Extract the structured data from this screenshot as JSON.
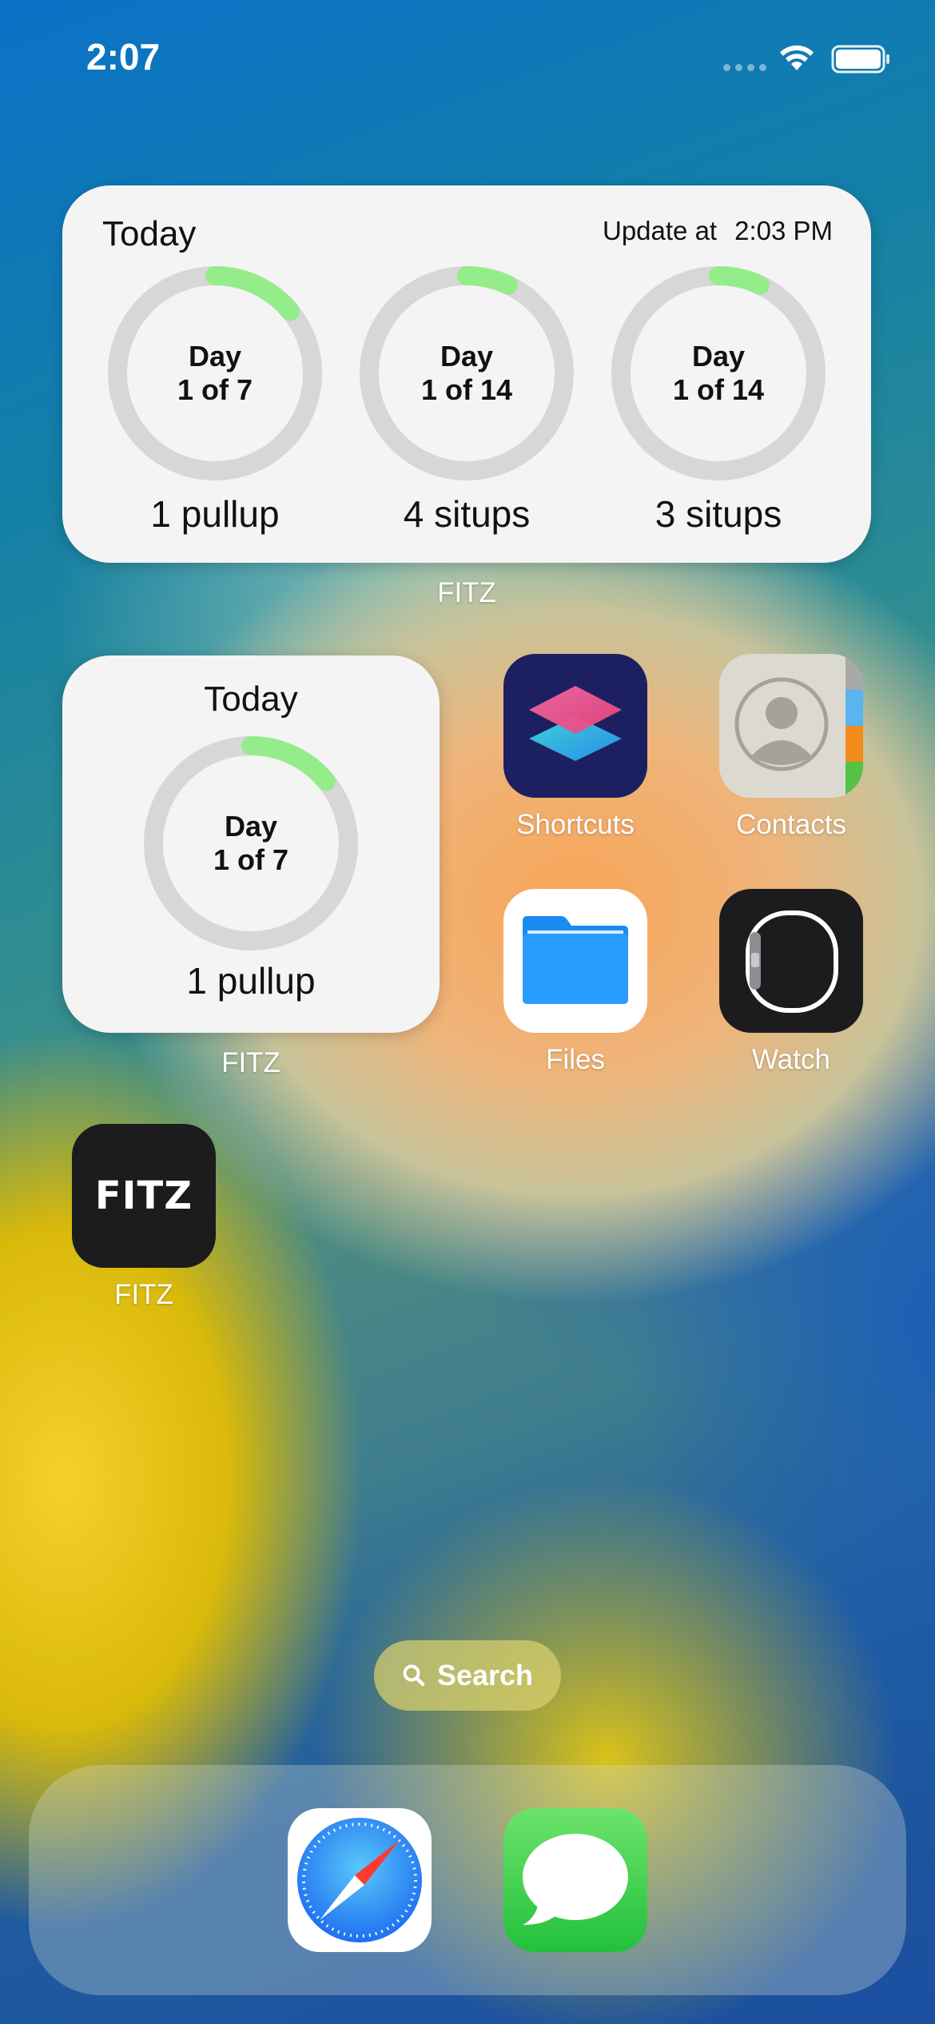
{
  "status_bar": {
    "time": "2:07"
  },
  "widget_large": {
    "title": "Today",
    "update_label": "Update at",
    "update_time": "2:03 PM",
    "rings": [
      {
        "line1": "Day",
        "line2": "1 of 7",
        "caption": "1 pullup",
        "progress": 0.14
      },
      {
        "line1": "Day",
        "line2": "1 of 14",
        "caption": "4 situps",
        "progress": 0.07
      },
      {
        "line1": "Day",
        "line2": "1 of 14",
        "caption": "3 situps",
        "progress": 0.07
      }
    ],
    "app_label": "FITZ"
  },
  "widget_small": {
    "title": "Today",
    "ring": {
      "line1": "Day",
      "line2": "1 of 7",
      "caption": "1 pullup",
      "progress": 0.14
    },
    "app_label": "FITZ"
  },
  "apps": {
    "shortcuts": "Shortcuts",
    "contacts": "Contacts",
    "files": "Files",
    "watch": "Watch",
    "fitz": "FITZ",
    "fitz_icon_text": "FITZ"
  },
  "search": {
    "label": "Search"
  },
  "dock": {
    "apps": [
      "safari-icon",
      "messages-icon"
    ]
  },
  "colors": {
    "ring_progress": "#95ec8a",
    "ring_track": "#d7d7d7"
  }
}
